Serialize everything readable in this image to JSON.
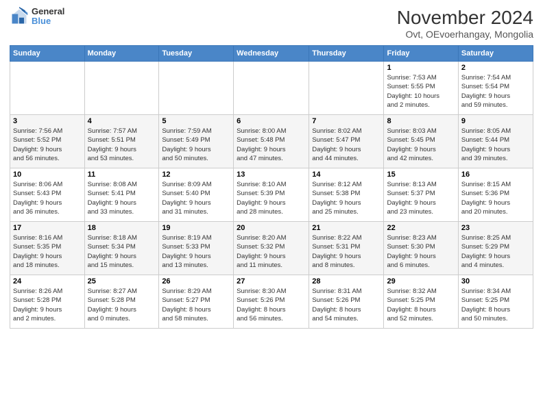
{
  "logo": {
    "line1": "General",
    "line2": "Blue"
  },
  "title": "November 2024",
  "subtitle": "Ovt, OEvoerhangay, Mongolia",
  "headers": [
    "Sunday",
    "Monday",
    "Tuesday",
    "Wednesday",
    "Thursday",
    "Friday",
    "Saturday"
  ],
  "weeks": [
    [
      {
        "day": "",
        "info": ""
      },
      {
        "day": "",
        "info": ""
      },
      {
        "day": "",
        "info": ""
      },
      {
        "day": "",
        "info": ""
      },
      {
        "day": "",
        "info": ""
      },
      {
        "day": "1",
        "info": "Sunrise: 7:53 AM\nSunset: 5:55 PM\nDaylight: 10 hours\nand 2 minutes."
      },
      {
        "day": "2",
        "info": "Sunrise: 7:54 AM\nSunset: 5:54 PM\nDaylight: 9 hours\nand 59 minutes."
      }
    ],
    [
      {
        "day": "3",
        "info": "Sunrise: 7:56 AM\nSunset: 5:52 PM\nDaylight: 9 hours\nand 56 minutes."
      },
      {
        "day": "4",
        "info": "Sunrise: 7:57 AM\nSunset: 5:51 PM\nDaylight: 9 hours\nand 53 minutes."
      },
      {
        "day": "5",
        "info": "Sunrise: 7:59 AM\nSunset: 5:49 PM\nDaylight: 9 hours\nand 50 minutes."
      },
      {
        "day": "6",
        "info": "Sunrise: 8:00 AM\nSunset: 5:48 PM\nDaylight: 9 hours\nand 47 minutes."
      },
      {
        "day": "7",
        "info": "Sunrise: 8:02 AM\nSunset: 5:47 PM\nDaylight: 9 hours\nand 44 minutes."
      },
      {
        "day": "8",
        "info": "Sunrise: 8:03 AM\nSunset: 5:45 PM\nDaylight: 9 hours\nand 42 minutes."
      },
      {
        "day": "9",
        "info": "Sunrise: 8:05 AM\nSunset: 5:44 PM\nDaylight: 9 hours\nand 39 minutes."
      }
    ],
    [
      {
        "day": "10",
        "info": "Sunrise: 8:06 AM\nSunset: 5:43 PM\nDaylight: 9 hours\nand 36 minutes."
      },
      {
        "day": "11",
        "info": "Sunrise: 8:08 AM\nSunset: 5:41 PM\nDaylight: 9 hours\nand 33 minutes."
      },
      {
        "day": "12",
        "info": "Sunrise: 8:09 AM\nSunset: 5:40 PM\nDaylight: 9 hours\nand 31 minutes."
      },
      {
        "day": "13",
        "info": "Sunrise: 8:10 AM\nSunset: 5:39 PM\nDaylight: 9 hours\nand 28 minutes."
      },
      {
        "day": "14",
        "info": "Sunrise: 8:12 AM\nSunset: 5:38 PM\nDaylight: 9 hours\nand 25 minutes."
      },
      {
        "day": "15",
        "info": "Sunrise: 8:13 AM\nSunset: 5:37 PM\nDaylight: 9 hours\nand 23 minutes."
      },
      {
        "day": "16",
        "info": "Sunrise: 8:15 AM\nSunset: 5:36 PM\nDaylight: 9 hours\nand 20 minutes."
      }
    ],
    [
      {
        "day": "17",
        "info": "Sunrise: 8:16 AM\nSunset: 5:35 PM\nDaylight: 9 hours\nand 18 minutes."
      },
      {
        "day": "18",
        "info": "Sunrise: 8:18 AM\nSunset: 5:34 PM\nDaylight: 9 hours\nand 15 minutes."
      },
      {
        "day": "19",
        "info": "Sunrise: 8:19 AM\nSunset: 5:33 PM\nDaylight: 9 hours\nand 13 minutes."
      },
      {
        "day": "20",
        "info": "Sunrise: 8:20 AM\nSunset: 5:32 PM\nDaylight: 9 hours\nand 11 minutes."
      },
      {
        "day": "21",
        "info": "Sunrise: 8:22 AM\nSunset: 5:31 PM\nDaylight: 9 hours\nand 8 minutes."
      },
      {
        "day": "22",
        "info": "Sunrise: 8:23 AM\nSunset: 5:30 PM\nDaylight: 9 hours\nand 6 minutes."
      },
      {
        "day": "23",
        "info": "Sunrise: 8:25 AM\nSunset: 5:29 PM\nDaylight: 9 hours\nand 4 minutes."
      }
    ],
    [
      {
        "day": "24",
        "info": "Sunrise: 8:26 AM\nSunset: 5:28 PM\nDaylight: 9 hours\nand 2 minutes."
      },
      {
        "day": "25",
        "info": "Sunrise: 8:27 AM\nSunset: 5:28 PM\nDaylight: 9 hours\nand 0 minutes."
      },
      {
        "day": "26",
        "info": "Sunrise: 8:29 AM\nSunset: 5:27 PM\nDaylight: 8 hours\nand 58 minutes."
      },
      {
        "day": "27",
        "info": "Sunrise: 8:30 AM\nSunset: 5:26 PM\nDaylight: 8 hours\nand 56 minutes."
      },
      {
        "day": "28",
        "info": "Sunrise: 8:31 AM\nSunset: 5:26 PM\nDaylight: 8 hours\nand 54 minutes."
      },
      {
        "day": "29",
        "info": "Sunrise: 8:32 AM\nSunset: 5:25 PM\nDaylight: 8 hours\nand 52 minutes."
      },
      {
        "day": "30",
        "info": "Sunrise: 8:34 AM\nSunset: 5:25 PM\nDaylight: 8 hours\nand 50 minutes."
      }
    ]
  ]
}
